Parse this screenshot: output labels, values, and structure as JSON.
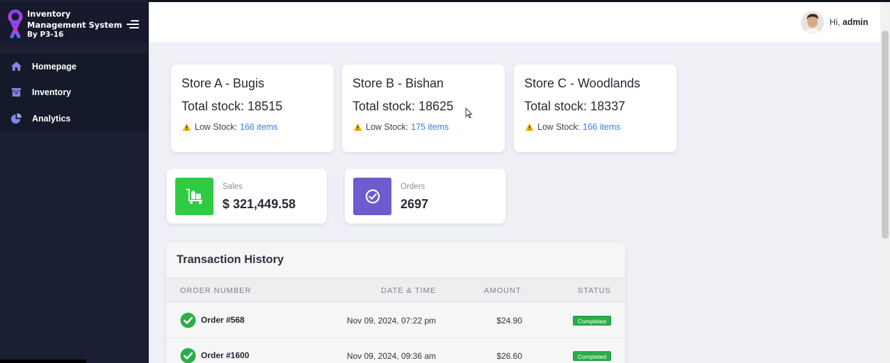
{
  "app": {
    "title": "Inventory Management System",
    "subtitle": "By P3-16",
    "accent": "#6a4df5"
  },
  "sidebar": {
    "items": [
      {
        "label": "Homepage",
        "icon": "home-icon"
      },
      {
        "label": "Inventory",
        "icon": "box-icon"
      },
      {
        "label": "Analytics",
        "icon": "pie-chart-icon"
      }
    ]
  },
  "header": {
    "greeting": "Hi,",
    "user": "admin"
  },
  "stores": [
    {
      "name": "Store A - Bugis",
      "total_stock": "Total stock: 18515",
      "low_label": "Low Stock:",
      "low_items": "166 items"
    },
    {
      "name": "Store B - Bishan",
      "total_stock": "Total stock: 18625",
      "low_label": "Low Stock:",
      "low_items": "175 items"
    },
    {
      "name": "Store C - Woodlands",
      "total_stock": "Total stock: 18337",
      "low_label": "Low Stock:",
      "low_items": "166 items"
    }
  ],
  "stats": {
    "sales": {
      "label": "Sales",
      "value": "$ 321,449.58",
      "color": "#2ecc40",
      "icon": "luggage-cart-icon"
    },
    "orders": {
      "label": "Orders",
      "value": "2697",
      "color": "#6c5ccf",
      "icon": "check-circle-icon"
    }
  },
  "transactions": {
    "title": "Transaction History",
    "columns": [
      "ORDER NUMBER",
      "DATE & TIME",
      "AMOUNT",
      "STATUS"
    ],
    "rows": [
      {
        "order": "Order #568",
        "datetime": "Nov 09, 2024, 07:22 pm",
        "amount": "$24.90",
        "status": "Completed"
      },
      {
        "order": "Order #1600",
        "datetime": "Nov 09, 2024, 09:36 am",
        "amount": "$26.60",
        "status": "Completed"
      }
    ]
  }
}
